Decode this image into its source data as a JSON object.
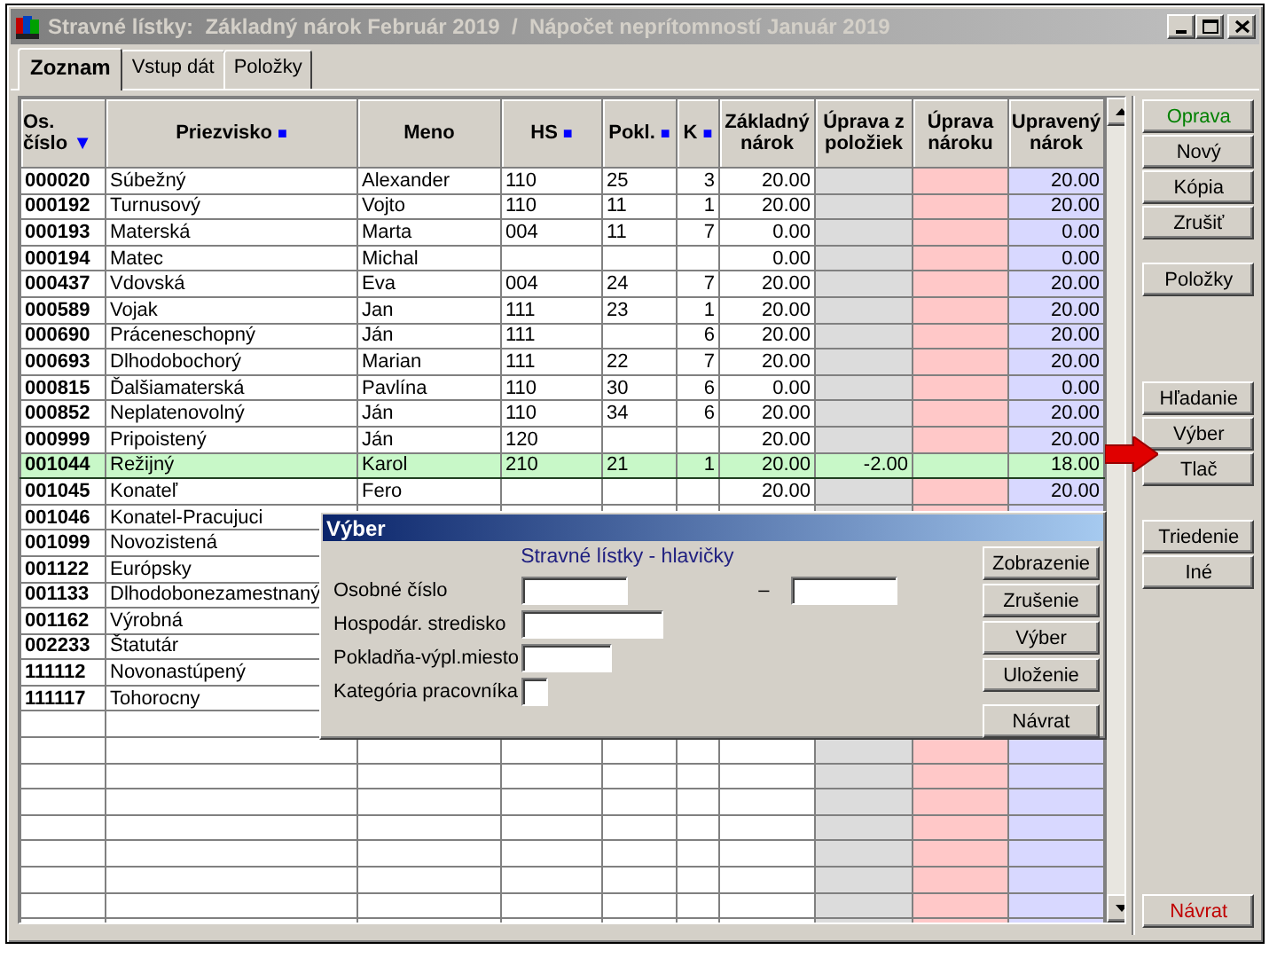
{
  "window": {
    "title": "Stravné lístky:  Základný nárok Február 2019  /  Nápočet neprítomností Január 2019",
    "active": false
  },
  "tabs": [
    {
      "label": "Zoznam",
      "selected": true
    },
    {
      "label": "Vstup dát",
      "selected": false
    },
    {
      "label": "Položky",
      "selected": false
    }
  ],
  "table": {
    "columns": [
      {
        "label": "Os. číslo",
        "marker": "▼"
      },
      {
        "label": "Priezvisko",
        "marker": "■"
      },
      {
        "label": "Meno"
      },
      {
        "label": "HS",
        "marker": "■"
      },
      {
        "label": "Pokl.",
        "marker": "■"
      },
      {
        "label": "K",
        "marker": "■"
      },
      {
        "label": "Základný nárok"
      },
      {
        "label": "Úprava z položiek",
        "color": "#dcdcdc"
      },
      {
        "label": "Úprava nároku",
        "color": "#ffc8c8"
      },
      {
        "label": "Upravený nárok",
        "color": "#d8d8ff"
      }
    ],
    "rows": [
      {
        "os_cislo": "000020",
        "priezvisko": "Súbežný",
        "meno": "Alexander",
        "hs": "110",
        "pokl": "25",
        "k": "3",
        "zakladny_narok": "20.00",
        "upraveny_narok": "20.00",
        "selected": false
      },
      {
        "os_cislo": "000192",
        "priezvisko": "Turnusový",
        "meno": "Vojto",
        "hs": "110",
        "pokl": "11",
        "k": "1",
        "zakladny_narok": "20.00",
        "upraveny_narok": "20.00",
        "selected": false
      },
      {
        "os_cislo": "000193",
        "priezvisko": "Materská",
        "meno": "Marta",
        "hs": "004",
        "pokl": "11",
        "k": "7",
        "zakladny_narok": "0.00",
        "upraveny_narok": "0.00",
        "selected": false
      },
      {
        "os_cislo": "000194",
        "priezvisko": "Matec",
        "meno": "Michal",
        "zakladny_narok": "0.00",
        "upraveny_narok": "0.00",
        "selected": false
      },
      {
        "os_cislo": "000437",
        "priezvisko": "Vdovská",
        "meno": "Eva",
        "hs": "004",
        "pokl": "24",
        "k": "7",
        "zakladny_narok": "20.00",
        "upraveny_narok": "20.00",
        "selected": false
      },
      {
        "os_cislo": "000589",
        "priezvisko": "Vojak",
        "meno": "Jan",
        "hs": "111",
        "pokl": "23",
        "k": "1",
        "zakladny_narok": "20.00",
        "upraveny_narok": "20.00",
        "selected": false
      },
      {
        "os_cislo": "000690",
        "priezvisko": "Práceneschopný",
        "meno": "Ján",
        "hs": "111",
        "k": "6",
        "zakladny_narok": "20.00",
        "upraveny_narok": "20.00",
        "selected": false
      },
      {
        "os_cislo": "000693",
        "priezvisko": "Dlhodobochorý",
        "meno": "Marian",
        "hs": "111",
        "pokl": "22",
        "k": "7",
        "zakladny_narok": "20.00",
        "upraveny_narok": "20.00",
        "selected": false
      },
      {
        "os_cislo": "000815",
        "priezvisko": "Ďalšiamaterská",
        "meno": "Pavlína",
        "hs": "110",
        "pokl": "30",
        "k": "6",
        "zakladny_narok": "0.00",
        "upraveny_narok": "0.00",
        "selected": false
      },
      {
        "os_cislo": "000852",
        "priezvisko": "Neplatenovolný",
        "meno": "Ján",
        "hs": "110",
        "pokl": "34",
        "k": "6",
        "zakladny_narok": "20.00",
        "upraveny_narok": "20.00",
        "selected": false
      },
      {
        "os_cislo": "000999",
        "priezvisko": "Pripoistený",
        "meno": "Ján",
        "hs": "120",
        "zakladny_narok": "20.00",
        "upraveny_narok": "20.00",
        "selected": false
      },
      {
        "os_cislo": "001044",
        "priezvisko": "Režijný",
        "meno": "Karol",
        "hs": "210",
        "pokl": "21",
        "k": "1",
        "zakladny_narok": "20.00",
        "uprava_z_poloziek": "-2.00",
        "upraveny_narok": "18.00",
        "selected": true
      },
      {
        "os_cislo": "001045",
        "priezvisko": "Konateľ",
        "meno": "Fero",
        "zakladny_narok": "20.00",
        "upraveny_narok": "20.00",
        "selected": false
      },
      {
        "os_cislo": "001046",
        "priezvisko": "Konatel-Pracujuci",
        "selected": false
      },
      {
        "os_cislo": "001099",
        "priezvisko": "Novozistená",
        "selected": false
      },
      {
        "os_cislo": "001122",
        "priezvisko": "Európsky",
        "selected": false
      },
      {
        "os_cislo": "001133",
        "priezvisko": "Dlhodobonezamestnaný",
        "selected": false
      },
      {
        "os_cislo": "001162",
        "priezvisko": "Výrobná",
        "selected": false
      },
      {
        "os_cislo": "002233",
        "priezvisko": "Štatutár",
        "selected": false
      },
      {
        "os_cislo": "111112",
        "priezvisko": "Novonastúpený",
        "selected": false
      },
      {
        "os_cislo": "111117",
        "priezvisko": "Tohorocny",
        "selected": false
      }
    ]
  },
  "side_buttons": [
    [
      {
        "label": "Oprava",
        "color": "#008000"
      },
      {
        "label": "Nový"
      },
      {
        "label": "Kópia"
      },
      {
        "label": "Zrušiť"
      }
    ],
    [
      {
        "label": "Položky"
      }
    ],
    [
      {
        "label": "Hľadanie"
      },
      {
        "label": "Výber"
      },
      {
        "label": "Tlač"
      }
    ],
    [
      {
        "label": "Triedenie"
      },
      {
        "label": "Iné"
      }
    ],
    [
      {
        "label": "Návrat",
        "color": "#c00000"
      }
    ]
  ],
  "dialog": {
    "title": "Výber",
    "subtitle": "Stravné lístky - hlavičky",
    "fields": [
      {
        "label": "Osobné číslo",
        "kind": "range",
        "separator": "–"
      },
      {
        "label": "Hospodár. stredisko",
        "kind": "single"
      },
      {
        "label": "Pokladňa-výpl.miesto",
        "kind": "single"
      },
      {
        "label": "Kategória pracovníka",
        "kind": "single"
      }
    ],
    "buttons": [
      {
        "label": "Zobrazenie"
      },
      {
        "label": "Zrušenie"
      },
      {
        "label": "Výber"
      },
      {
        "label": "Uloženie"
      },
      {
        "label": "Návrat"
      }
    ]
  }
}
